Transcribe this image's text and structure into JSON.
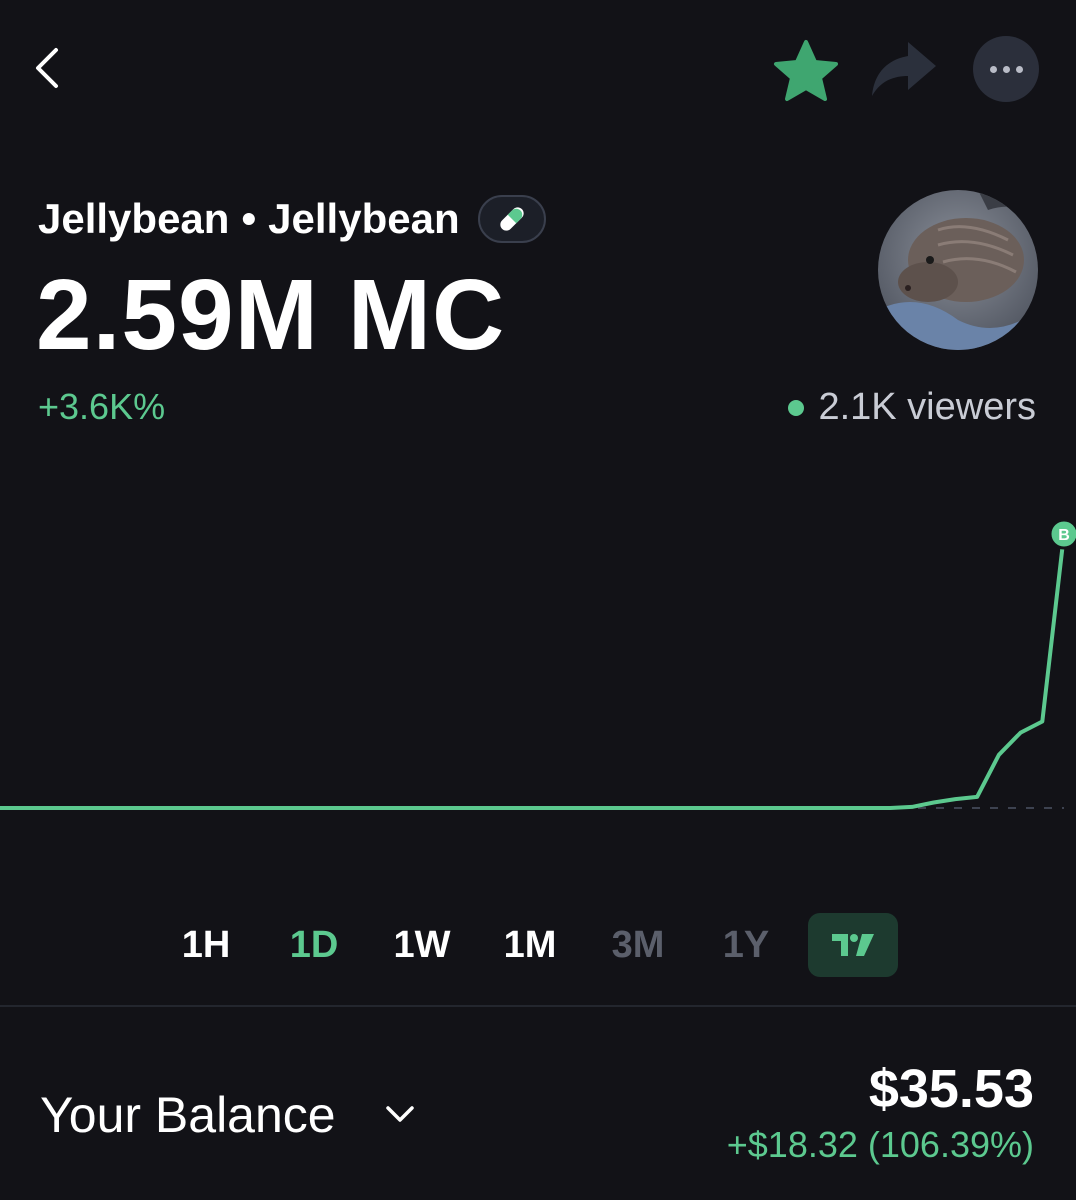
{
  "header": {
    "back_icon": "chevron-left-icon",
    "favorite_icon": "star-icon",
    "share_icon": "share-arrow-icon",
    "more_icon": "ellipsis-icon"
  },
  "token": {
    "name": "Jellybean",
    "separator": "•",
    "symbol": "Jellybean",
    "badge_icon": "pill-icon",
    "market_cap": "2.59M MC",
    "change": "+3.6K%",
    "viewers": "2.1K viewers",
    "avatar_icon": "token-avatar-image"
  },
  "chart_data": {
    "type": "line",
    "values": [
      0.12,
      0.12,
      0.12,
      0.12,
      0.12,
      0.12,
      0.12,
      0.12,
      0.12,
      0.12,
      0.12,
      0.12,
      0.12,
      0.12,
      0.12,
      0.12,
      0.12,
      0.12,
      0.12,
      0.12,
      0.12,
      0.12,
      0.12,
      0.12,
      0.12,
      0.12,
      0.12,
      0.12,
      0.12,
      0.12,
      0.12,
      0.12,
      0.12,
      0.12,
      0.12,
      0.12,
      0.12,
      0.12,
      0.12,
      0.12,
      0.12,
      0.12,
      0.13,
      0.17,
      0.2,
      0.22,
      0.6,
      0.8,
      0.9,
      2.59
    ],
    "marker": "B",
    "baseline_dashed": true,
    "color": "#5cc98f"
  },
  "timeframes": [
    {
      "label": "1H",
      "state": "normal"
    },
    {
      "label": "1D",
      "state": "active"
    },
    {
      "label": "1W",
      "state": "normal"
    },
    {
      "label": "1M",
      "state": "normal"
    },
    {
      "label": "3M",
      "state": "dim"
    },
    {
      "label": "1Y",
      "state": "dim"
    }
  ],
  "tradingview_icon": "tradingview-icon",
  "balance": {
    "label": "Your Balance",
    "chevron_icon": "chevron-down-icon",
    "value": "$35.53",
    "change": "+$18.32 (106.39%)"
  },
  "colors": {
    "background": "#121217",
    "accent": "#5cc98f",
    "dim": "#5b5f6b"
  }
}
